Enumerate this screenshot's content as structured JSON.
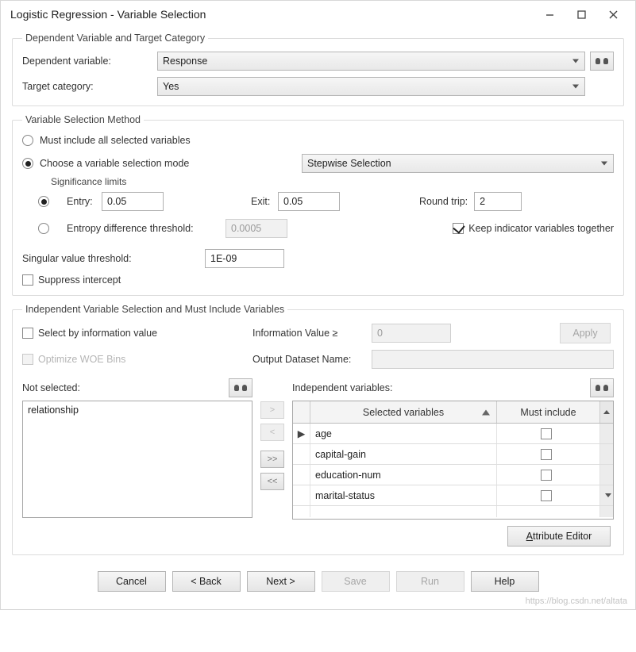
{
  "window": {
    "title": "Logistic Regression - Variable Selection"
  },
  "group1": {
    "legend": "Dependent Variable and Target Category",
    "dep_label": "Dependent variable:",
    "dep_value": "Response",
    "target_label": "Target category:",
    "target_value": "Yes"
  },
  "group2": {
    "legend": "Variable Selection Method",
    "opt_all": "Must include all selected variables",
    "opt_mode": "Choose a variable selection mode",
    "mode_value": "Stepwise Selection",
    "sig_legend": "Significance limits",
    "entry_label": "Entry:",
    "entry_value": "0.05",
    "exit_label": "Exit:",
    "exit_value": "0.05",
    "round_label": "Round trip:",
    "round_value": "2",
    "entropy_label": "Entropy difference threshold:",
    "entropy_value": "0.0005",
    "keep_label": "Keep indicator variables together",
    "singular_label": "Singular value threshold:",
    "singular_value": "1E-09",
    "suppress_label": "Suppress intercept"
  },
  "group3": {
    "legend": "Independent Variable Selection and Must Include Variables",
    "selinfo_label": "Select by information value",
    "infoval_label": "Information Value ≥",
    "infoval_value": "0",
    "apply_label": "Apply",
    "optwoe_label": "Optimize WOE Bins",
    "outds_label": "Output Dataset Name:",
    "outds_value": "",
    "notsel_label": "Not selected:",
    "notsel_items": [
      "relationship"
    ],
    "indep_label": "Independent variables:",
    "col_sel": "Selected variables",
    "col_must": "Must include",
    "rows": [
      {
        "name": "age",
        "must": false
      },
      {
        "name": "capital-gain",
        "must": false
      },
      {
        "name": "education-num",
        "must": false
      },
      {
        "name": "marital-status",
        "must": false
      }
    ],
    "attr_editor": "Attribute Editor",
    "move": {
      "r": ">",
      "l": "<",
      "rr": ">>",
      "ll": "<<"
    }
  },
  "footer": {
    "cancel": "Cancel",
    "back": "< Back",
    "next": "Next >",
    "save": "Save",
    "run": "Run",
    "help": "Help"
  },
  "watermark": "https://blog.csdn.net/altata"
}
